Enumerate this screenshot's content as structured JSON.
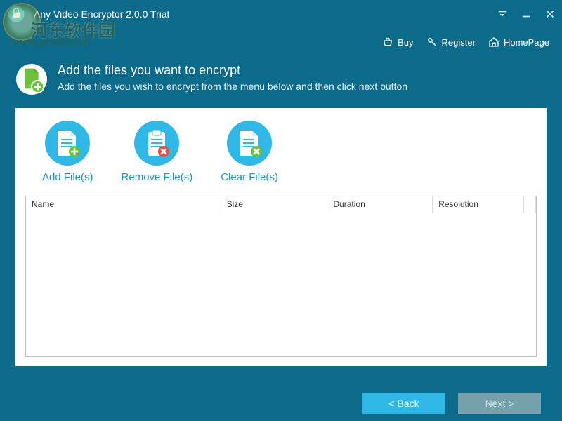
{
  "window": {
    "title": "Any Video Encryptor 2.0.0 Trial"
  },
  "menu": {
    "buy": "Buy",
    "register": "Register",
    "homepage": "HomePage"
  },
  "header": {
    "title": "Add the files you want to encrypt",
    "subtitle": "Add the files you wish to encrypt from the menu below and then click next button"
  },
  "actions": {
    "add": "Add File(s)",
    "remove": "Remove File(s)",
    "clear": "Clear File(s)"
  },
  "table": {
    "columns": {
      "name": "Name",
      "size": "Size",
      "duration": "Duration",
      "resolution": "Resolution"
    },
    "rows": []
  },
  "footer": {
    "back": "<  Back",
    "next": "Next  >"
  },
  "watermark": {
    "line1": "河东软件园",
    "line2": "www.pc0359.cn"
  }
}
